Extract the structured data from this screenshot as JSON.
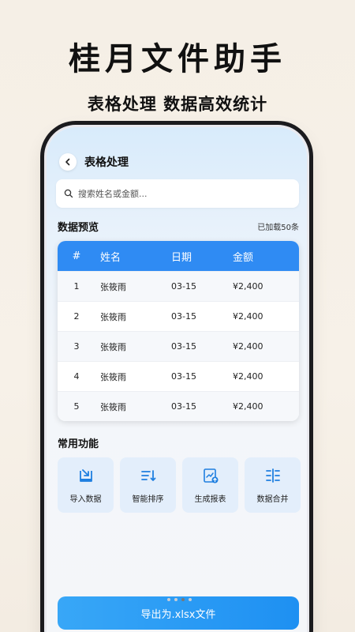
{
  "hero": {
    "title": "桂月文件助手",
    "subtitle": "表格处理 数据高效统计"
  },
  "header": {
    "title": "表格处理",
    "back_icon": "chevron-left-icon"
  },
  "search": {
    "placeholder": "搜索姓名或金额...",
    "icon": "search-icon"
  },
  "preview": {
    "title": "数据预览",
    "meta": "已加载50条",
    "columns": [
      "#",
      "姓名",
      "日期",
      "金额"
    ],
    "rows": [
      {
        "index": "1",
        "name": "张筱雨",
        "date": "03-15",
        "amount": "¥2,400"
      },
      {
        "index": "2",
        "name": "张筱雨",
        "date": "03-15",
        "amount": "¥2,400"
      },
      {
        "index": "3",
        "name": "张筱雨",
        "date": "03-15",
        "amount": "¥2,400"
      },
      {
        "index": "4",
        "name": "张筱雨",
        "date": "03-15",
        "amount": "¥2,400"
      },
      {
        "index": "5",
        "name": "张筱雨",
        "date": "03-15",
        "amount": "¥2,400"
      }
    ]
  },
  "functions": {
    "title": "常用功能",
    "items": [
      {
        "label": "导入数据",
        "icon": "import-icon"
      },
      {
        "label": "智能排序",
        "icon": "sort-icon"
      },
      {
        "label": "生成报表",
        "icon": "report-icon"
      },
      {
        "label": "数据合并",
        "icon": "merge-icon"
      }
    ]
  },
  "footer": {
    "export_label": "导出为.xlsx文件"
  },
  "colors": {
    "accent": "#2f8bf3",
    "tile_bg": "#e3eefb"
  }
}
